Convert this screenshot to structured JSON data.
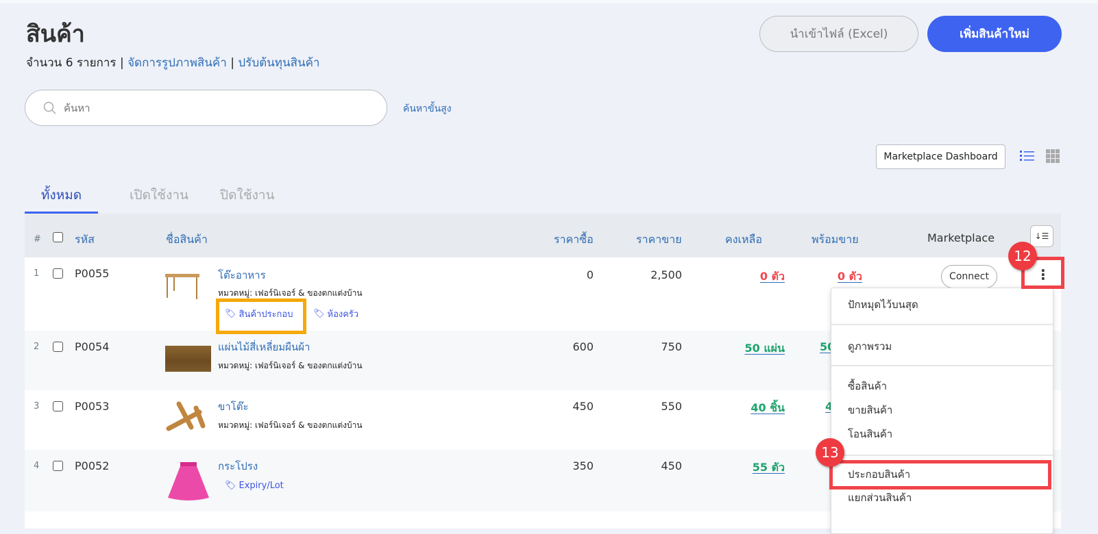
{
  "header": {
    "title": "สินค้า",
    "count_text": "จำนวน 6 รายการ",
    "link_images": "จัดการรูปภาพสินค้า",
    "link_cost": "ปรับต้นทุนสินค้า",
    "separator": "|",
    "import_label": "นำเข้าไฟล์ (Excel)",
    "add_label": "เพิ่มสินค้าใหม่"
  },
  "search": {
    "placeholder": "ค้นหา",
    "value": "",
    "advanced": "ค้นหาขั้นสูง"
  },
  "toolbar": {
    "marketplace_dashboard": "Marketplace Dashboard",
    "view_list_icon": "list-icon",
    "view_grid_icon": "grid-icon"
  },
  "tabs": [
    {
      "label": "ทั้งหมด",
      "active": true
    },
    {
      "label": "เปิดใช้งาน"
    },
    {
      "label": "ปิดใช้งาน"
    }
  ],
  "columns": {
    "index": "#",
    "code": "รหัส",
    "name": "ชื่อสินค้า",
    "buy": "ราคาซื้อ",
    "sell": "ราคาขาย",
    "remain": "คงเหลือ",
    "ready": "พร้อมขาย",
    "marketplace": "Marketplace"
  },
  "rows": [
    {
      "index": "1",
      "code": "P0055",
      "name": "โต๊ะอาหาร",
      "category": "หมวดหมู่: เฟอร์นิเจอร์ & ของตกแต่งบ้าน",
      "tags": [
        "สินค้าประกอบ",
        "ห้องครัว"
      ],
      "buy": "0",
      "sell": "2,500",
      "remain": "0 ตัว",
      "ready": "0 ตัว",
      "status": "red",
      "marketplace": "Connect"
    },
    {
      "index": "2",
      "code": "P0054",
      "name": "แผ่นไม้สี่เหลี่ยมผืนผ้า",
      "category": "หมวดหมู่: เฟอร์นิเจอร์ & ของตกแต่งบ้าน",
      "tags": [],
      "buy": "600",
      "sell": "750",
      "remain": "50 แผ่น",
      "ready": "50",
      "status": "green"
    },
    {
      "index": "3",
      "code": "P0053",
      "name": "ขาโต๊ะ",
      "category": "หมวดหมู่: เฟอร์นิเจอร์ & ของตกแต่งบ้าน",
      "tags": [],
      "buy": "450",
      "sell": "550",
      "remain": "40 ชิ้น",
      "ready": "4",
      "status": "green"
    },
    {
      "index": "4",
      "code": "P0052",
      "name": "กระโปรง",
      "category": "",
      "tags": [
        "Expiry/Lot"
      ],
      "buy": "350",
      "sell": "450",
      "remain": "55 ตัว",
      "ready": "",
      "status": "green"
    }
  ],
  "menu": {
    "items": [
      "ปักหมุดไว้บนสุด",
      "ดูภาพรวม",
      "ซื้อสินค้า",
      "ขายสินค้า",
      "โอนสินค้า",
      "ประกอบสินค้า",
      "แยกส่วนสินค้า"
    ]
  },
  "annotations": {
    "step_kebab": "12",
    "step_assemble": "13"
  },
  "colors": {
    "accent": "#3d63f0",
    "link": "#2f6db5",
    "out_of_stock": "#f0474f",
    "in_stock": "#1ea36d",
    "highlight_red": "#f0434a",
    "highlight_orange": "#f5a80a"
  }
}
